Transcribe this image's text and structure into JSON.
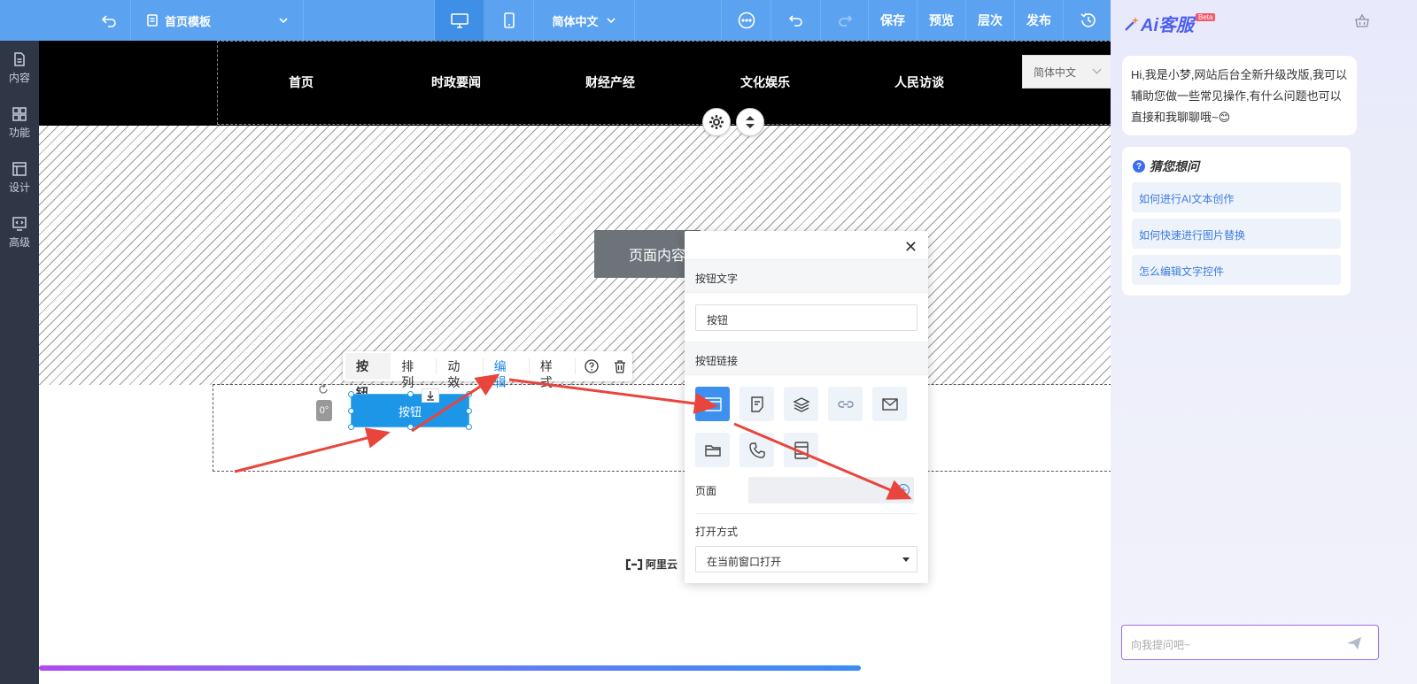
{
  "topbar": {
    "template_name": "首页模板",
    "language": "简体中文",
    "save": "保存",
    "preview": "预览",
    "layers": "层次",
    "publish": "发布"
  },
  "leftbar": {
    "items": [
      {
        "label": "内容",
        "icon": "document-icon"
      },
      {
        "label": "功能",
        "icon": "grid-icon"
      },
      {
        "label": "设计",
        "icon": "layout-icon"
      },
      {
        "label": "高级",
        "icon": "code-monitor-icon"
      }
    ]
  },
  "canvas": {
    "nav": [
      "首页",
      "时政要闻",
      "财经产经",
      "文化娱乐",
      "人民访谈"
    ],
    "language_select": "简体中文",
    "page_content_label": "页面内容",
    "button_text": "按钮",
    "rotation": "0°",
    "footer_brand": "阿里云"
  },
  "element_toolbar": {
    "items": [
      "按钮",
      "排列",
      "动效",
      "编辑",
      "样式"
    ]
  },
  "edit_popup": {
    "button_text_heading": "按钮文字",
    "button_text_value": "按钮",
    "button_link_heading": "按钮链接",
    "page_label": "页面",
    "open_mode_label": "打开方式",
    "open_mode_value": "在当前窗口打开"
  },
  "ai_panel": {
    "logo": "Ai客服",
    "beta": "Beta",
    "greeting": "Hi,我是小梦,网站后台全新升级改版,我可以辅助您做一些常见操作,有什么问题也可以直接和我聊聊哦~😊",
    "guess_title": "猜您想问",
    "questions": [
      "如何进行AI文本创作",
      "如何快速进行图片替换",
      "怎么编辑文字控件"
    ],
    "input_placeholder": "向我提问吧~"
  },
  "colors": {
    "toolbar": "#5ba3f0",
    "sidebar": "#2f3747",
    "accent": "#1e96e8",
    "arrow": "#e8453c"
  }
}
